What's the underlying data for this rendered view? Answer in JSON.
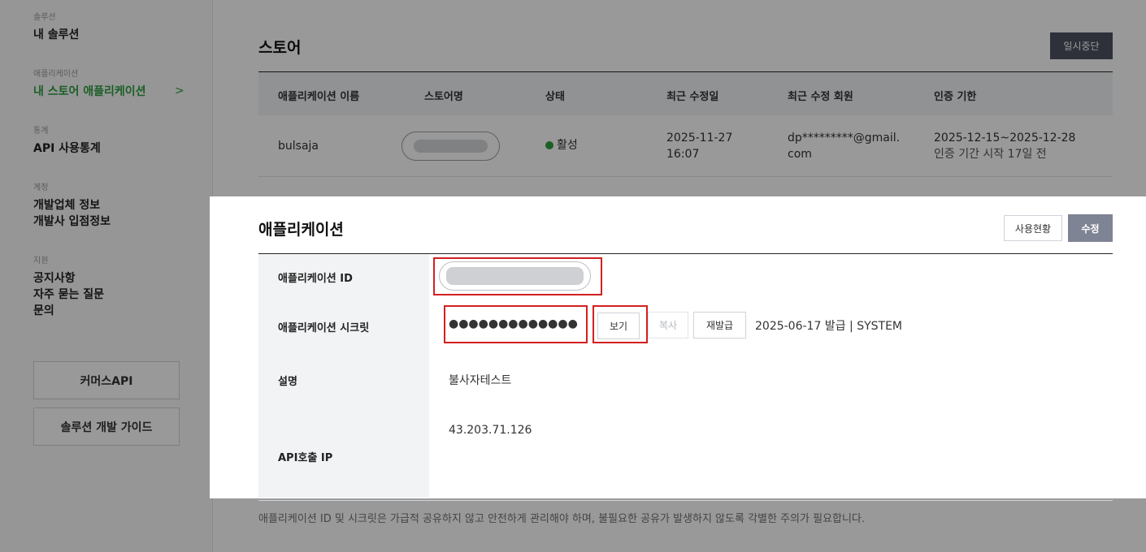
{
  "sidebar": {
    "groups": [
      {
        "caption": "솔루션",
        "items": [
          "내 솔루션"
        ]
      },
      {
        "caption": "애플리케이션",
        "items": [
          "내 스토어 애플리케이션"
        ]
      },
      {
        "caption": "통계",
        "items": [
          "API 사용통계"
        ]
      },
      {
        "caption": "계정",
        "items": [
          "개발업체 정보",
          "개발사 입점정보"
        ]
      },
      {
        "caption": "지원",
        "items": [
          "공지사항",
          "자주 묻는 질문",
          "문의"
        ]
      }
    ],
    "chevron": ">",
    "buttons": [
      "커머스API",
      "솔루션 개발 가이드"
    ]
  },
  "store": {
    "title": "스토어",
    "pause_label": "일시중단",
    "columns": [
      "애플리케이션 이름",
      "스토어명",
      "상태",
      "최근 수정일",
      "최근 수정 회원",
      "인증 기한"
    ],
    "row": {
      "app_name": "bulsaja",
      "status": "활성",
      "modified_date": "2025-11-27",
      "modified_time": "16:07",
      "member_line1": "dp*********@gmail.",
      "member_line2": "com",
      "auth_period": "2025-12-15~2025-12-28",
      "auth_note": "인증 기간 시작 17일 전"
    },
    "status_color": "#2e9e3e"
  },
  "application": {
    "title": "애플리케이션",
    "usage_label": "사용현황",
    "edit_label": "수정",
    "id_label": "애플리케이션 ID",
    "secret_label": "애플리케이션 시크릿",
    "secret_mask": "●●●●●●●●●●●●●",
    "view_label": "보기",
    "copy_label": "복사",
    "reissue_label": "재발급",
    "issued_info": "2025-06-17 발급 | SYSTEM",
    "desc_label": "설명",
    "desc_value": "불사자테스트",
    "ip_label": "API호출 IP",
    "ip_value": "43.203.71.126"
  },
  "notice": "애플리케이션 ID 및 시크릿은 가급적 공유하지 않고 안전하게 관리해야 하며, 불필요한 공유가 발생하지 않도록 각별한 주의가 필요합니다.",
  "colors": {
    "accent_green": "#2e9e3e",
    "highlight_red": "#d32020",
    "dark_button": "#4d5260",
    "edit_button": "#7f8494"
  }
}
